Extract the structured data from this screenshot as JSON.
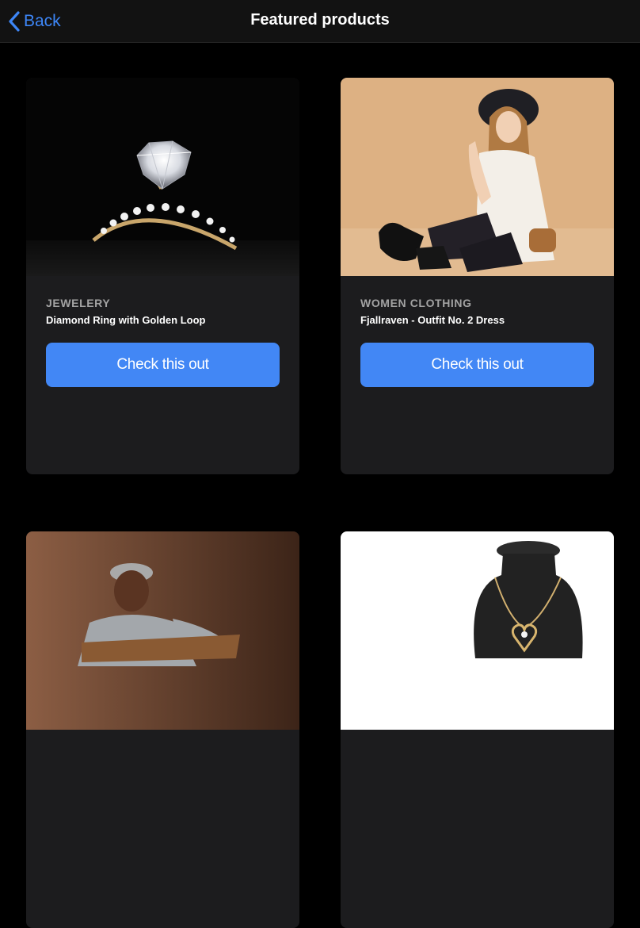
{
  "nav": {
    "back_label": "Back",
    "title": "Featured products"
  },
  "products": [
    {
      "category": "JEWELERY",
      "name": "Diamond Ring with Golden Loop",
      "cta": "Check this out",
      "image": "diamond-ring-photo"
    },
    {
      "category": "WOMEN CLOTHING",
      "name": "Fjallraven - Outfit No. 2 Dress",
      "cta": "Check this out",
      "image": "woman-in-hat-photo"
    },
    {
      "image": "man-sitting-photo"
    },
    {
      "image": "heart-necklace-photo"
    }
  ],
  "colors": {
    "accent": "#4287f5",
    "background": "#000000",
    "card": "#1c1c1e"
  }
}
